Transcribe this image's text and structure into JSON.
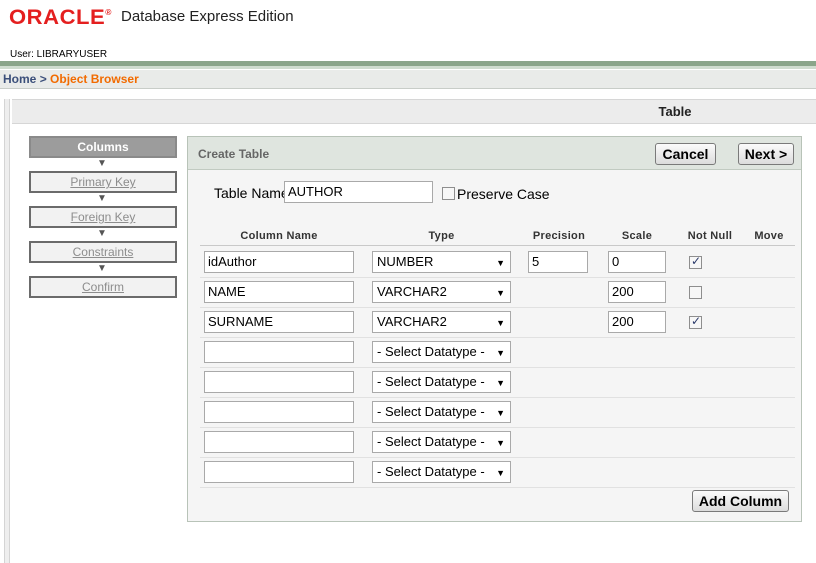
{
  "header": {
    "logo_text": "ORACLE",
    "logo_reg": "®",
    "app_name": "Database Express Edition",
    "user_line": "User: LIBRARYUSER"
  },
  "breadcrumb": {
    "home": "Home",
    "separator": ">",
    "current": "Object Browser"
  },
  "section_title": "Table",
  "wizard": {
    "steps": [
      {
        "label": "Columns",
        "active": true
      },
      {
        "label": "Primary Key",
        "active": false
      },
      {
        "label": "Foreign Key",
        "active": false
      },
      {
        "label": "Constraints",
        "active": false
      },
      {
        "label": "Confirm",
        "active": false
      }
    ],
    "chevron": "▼"
  },
  "panel": {
    "title": "Create Table",
    "cancel_label": "Cancel",
    "next_label": "Next >",
    "table_name_label": "Table Name",
    "table_name_value": "AUTHOR",
    "preserve_case_label": "Preserve Case",
    "preserve_case_checked": false,
    "add_column_label": "Add Column"
  },
  "columns_table": {
    "headers": {
      "column_name": "Column Name",
      "type": "Type",
      "precision": "Precision",
      "scale": "Scale",
      "not_null": "Not Null",
      "move": "Move"
    },
    "rows": [
      {
        "name": "idAuthor",
        "type": "NUMBER",
        "precision": "5",
        "scale": "0",
        "not_null": true,
        "show_precision": true,
        "show_scale": true,
        "show_not_null": true
      },
      {
        "name": "NAME",
        "type": "VARCHAR2",
        "precision": "",
        "scale": "200",
        "not_null": false,
        "show_precision": false,
        "show_scale": true,
        "show_not_null": true
      },
      {
        "name": "SURNAME",
        "type": "VARCHAR2",
        "precision": "",
        "scale": "200",
        "not_null": true,
        "show_precision": false,
        "show_scale": true,
        "show_not_null": true
      },
      {
        "name": "",
        "type": "- Select Datatype -",
        "precision": "",
        "scale": "",
        "not_null": false,
        "show_precision": false,
        "show_scale": false,
        "show_not_null": false
      },
      {
        "name": "",
        "type": "- Select Datatype -",
        "precision": "",
        "scale": "",
        "not_null": false,
        "show_precision": false,
        "show_scale": false,
        "show_not_null": false
      },
      {
        "name": "",
        "type": "- Select Datatype -",
        "precision": "",
        "scale": "",
        "not_null": false,
        "show_precision": false,
        "show_scale": false,
        "show_not_null": false
      },
      {
        "name": "",
        "type": "- Select Datatype -",
        "precision": "",
        "scale": "",
        "not_null": false,
        "show_precision": false,
        "show_scale": false,
        "show_not_null": false
      },
      {
        "name": "",
        "type": "- Select Datatype -",
        "precision": "",
        "scale": "",
        "not_null": false,
        "show_precision": false,
        "show_scale": false,
        "show_not_null": false
      }
    ]
  },
  "colors": {
    "brand_red": "#e41f1f",
    "breadcrumb_current": "#f26b00",
    "header_band": "#8aa58a",
    "panel_head": "#dfe5df"
  }
}
